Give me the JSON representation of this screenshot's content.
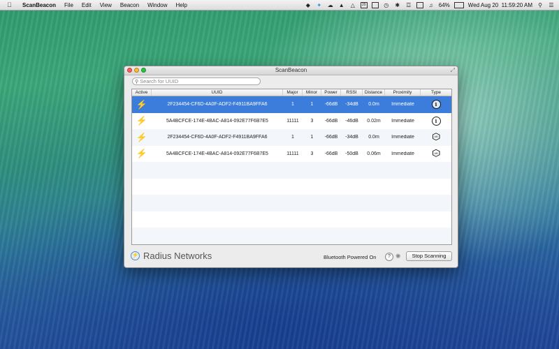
{
  "menubar": {
    "app_name": "ScanBeacon",
    "menus": [
      "File",
      "Edit",
      "View",
      "Beacon",
      "Window",
      "Help"
    ],
    "battery": "64%",
    "clock": "Wed Aug 20  11:59:20 AM"
  },
  "window": {
    "title": "ScanBeacon",
    "search_placeholder": "Search for UUID",
    "columns": [
      "Active",
      "UUID",
      "Major",
      "Minor",
      "Power",
      "RSSI",
      "Distance",
      "Proximity",
      "Type"
    ],
    "rows": [
      {
        "uuid": "2F234454-CF6D-4A0F-ADF2-F4911BA9FFA6",
        "major": "1",
        "minor": "1",
        "power": "-66dB",
        "rssi": "-34dB",
        "distance": "0.0m",
        "proximity": "Immediate",
        "type": "info"
      },
      {
        "uuid": "5A4BCFCE-174E-4BAC-A814-092E77F6B7E5",
        "major": "11111",
        "minor": "3",
        "power": "-66dB",
        "rssi": "-46dB",
        "distance": "0.02m",
        "proximity": "Immediate",
        "type": "info"
      },
      {
        "uuid": "2F234454-CF6D-4A0F-ADF2-F4911BA9FFA6",
        "major": "1",
        "minor": "1",
        "power": "-66dB",
        "rssi": "-34dB",
        "distance": "0.0m",
        "proximity": "Immediate",
        "type": "altbeacon"
      },
      {
        "uuid": "5A4BCFCE-174E-4BAC-A814-092E77F6B7E5",
        "major": "11111",
        "minor": "3",
        "power": "-66dB",
        "rssi": "-50dB",
        "distance": "0.06m",
        "proximity": "Immediate",
        "type": "altbeacon"
      }
    ],
    "selected_row": 0,
    "brand": "Radius Networks",
    "bluetooth_status": "Bluetooth Powered On",
    "help_label": "?",
    "stop_button": "Stop Scanning"
  },
  "icons": {
    "active": "lightning-bolt-icon",
    "type_info": "info-circle-icon",
    "type_altbeacon": "altbeacon-hexagon-icon"
  },
  "colors": {
    "selection": "#3c7ddb",
    "active_bolt": "#5cb33b",
    "brand": "#3a90d6"
  }
}
